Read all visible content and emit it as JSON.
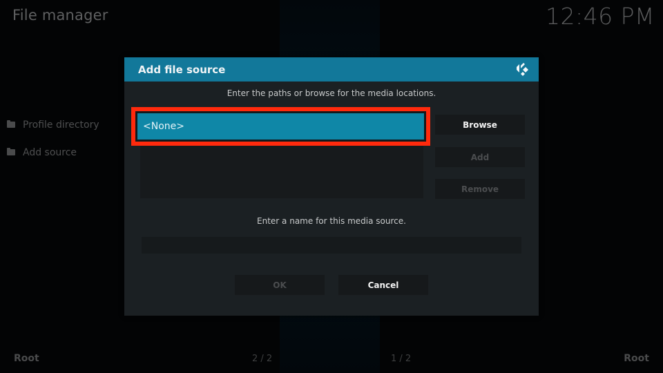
{
  "window": {
    "title": "File manager",
    "clock": "12:46 PM"
  },
  "sidebar": {
    "items": [
      {
        "label": "Profile directory",
        "icon": "folder-icon"
      },
      {
        "label": "Add source",
        "icon": "folder-icon"
      }
    ]
  },
  "dialog": {
    "title": "Add file source",
    "logo_icon": "kodi-logo-icon",
    "path_instruction": "Enter the paths or browse for the media locations.",
    "paths": [
      {
        "label": "<None>",
        "selected": true
      }
    ],
    "buttons": {
      "browse": "Browse",
      "add": "Add",
      "remove": "Remove",
      "ok": "OK",
      "cancel": "Cancel"
    },
    "name_instruction": "Enter a name for this media source.",
    "name_value": "",
    "colors": {
      "header": "#12789a",
      "selected_item": "#0f87a7",
      "highlight_box": "#ff2a0d"
    }
  },
  "footer": {
    "left_label": "Root",
    "left_page": "2 / 2",
    "right_page": "1 / 2",
    "right_label": "Root"
  }
}
